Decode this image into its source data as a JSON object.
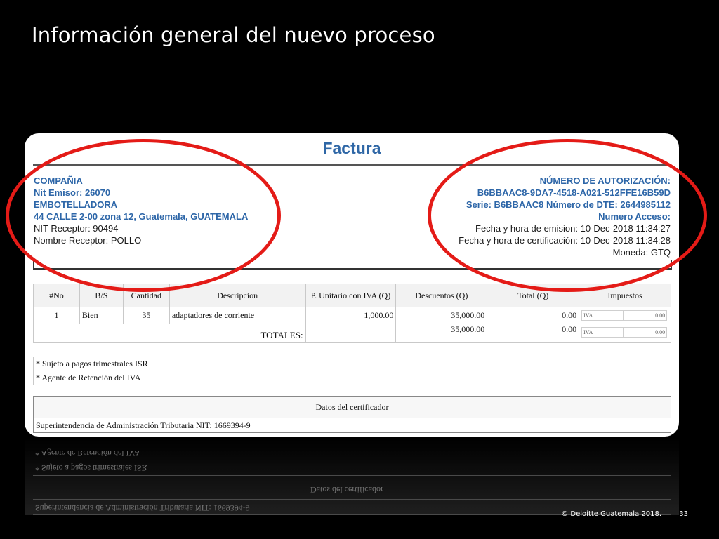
{
  "slide": {
    "title": "Información general del nuevo proceso",
    "copyright": "© Deloitte Guatemala 2018.",
    "page": "33"
  },
  "invoice": {
    "title": "Factura",
    "issuer": {
      "company_label": "COMPAÑIA",
      "nit_emisor": "Nit Emisor:   26070",
      "name": "EMBOTELLADORA",
      "address": "44 CALLE  2-00 zona 12, Guatemala, GUATEMALA",
      "nit_receptor": "NIT Receptor: 90494",
      "nombre_receptor": "Nombre Receptor: POLLO"
    },
    "authorization": {
      "label": "NÚMERO DE AUTORIZACIÓN:",
      "number": "B6BBAAC8-9DA7-4518-A021-512FFE16B59D",
      "serie": "Serie: B6BBAAC8 Número de DTE: 2644985112",
      "acceso": "Numero Acceso:",
      "emision": "Fecha y hora de emision: 10-Dec-2018 11:34:27",
      "certificacion": "Fecha y hora de certificación: 10-Dec-2018 11:34:28",
      "moneda": "Moneda: GTQ"
    },
    "table": {
      "headers": [
        "#No",
        "B/S",
        "Cantidad",
        "Descripcion",
        "P. Unitario con IVA (Q)",
        "Descuentos (Q)",
        "Total (Q)",
        "Impuestos"
      ],
      "rows": [
        {
          "no": "1",
          "bs": "Bien",
          "cantidad": "35",
          "descripcion": "adaptadores de corriente",
          "precio": "1,000.00",
          "descuentos": "35,000.00",
          "total": "0.00",
          "tax_name": "IVA",
          "tax_value": "0.00"
        }
      ],
      "totals": {
        "label": "TOTALES:",
        "descuentos": "35,000.00",
        "total": "0.00",
        "tax_name": "IVA",
        "tax_value": "0.00"
      }
    },
    "notes": [
      "* Sujeto a pagos trimestrales ISR",
      "* Agente de Retención del IVA"
    ],
    "certifier": {
      "header": "Datos del certificador",
      "body": "Superintendencia de Administración Tributaria NIT: 1669394-9"
    }
  },
  "colors": {
    "highlight_ring": "#e41b17",
    "title_blue": "#2f67a6",
    "background": "#000000"
  }
}
